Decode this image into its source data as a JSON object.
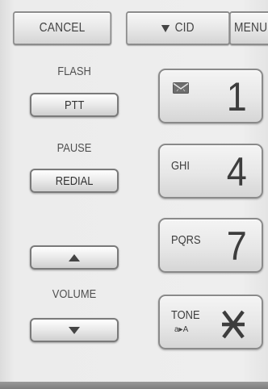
{
  "top_keys": {
    "cancel": "CANCEL",
    "cid": "CID",
    "menu": "MENU"
  },
  "left": {
    "flash_label": "FLASH",
    "ptt_button": "PTT",
    "pause_label": "PAUSE",
    "redial_button": "REDIAL",
    "volume_label": "VOLUME",
    "volume_up_icon": "triangle-up-icon",
    "volume_down_icon": "triangle-down-icon"
  },
  "keypad": {
    "key1": {
      "digit": "1",
      "icon": "voicemail-envelope-icon"
    },
    "key4": {
      "digit": "4",
      "letters": "GHI"
    },
    "key7": {
      "digit": "7",
      "letters": "PQRS"
    },
    "star": {
      "symbol": "*",
      "letters": "TONE",
      "sub": "a▸A"
    }
  },
  "colors": {
    "panel": "#ececec",
    "key_text": "#3d3d3d",
    "bottom_bar": "#8a8a8a"
  }
}
